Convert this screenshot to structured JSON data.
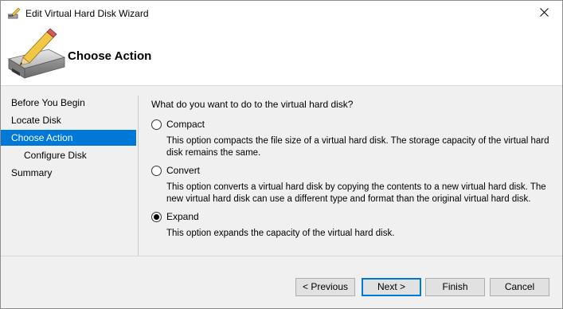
{
  "window": {
    "title": "Edit Virtual Hard Disk Wizard",
    "close_glyph": "✕"
  },
  "header": {
    "title": "Choose Action"
  },
  "nav": {
    "items": [
      {
        "label": "Before You Begin",
        "active": false,
        "sub": false
      },
      {
        "label": "Locate Disk",
        "active": false,
        "sub": false
      },
      {
        "label": "Choose Action",
        "active": true,
        "sub": false
      },
      {
        "label": "Configure Disk",
        "active": false,
        "sub": true
      },
      {
        "label": "Summary",
        "active": false,
        "sub": false
      }
    ],
    "active_color": "#0078d7"
  },
  "main": {
    "question": "What do you want to do to the virtual hard disk?",
    "options": [
      {
        "label": "Compact",
        "checked": false,
        "description": "This option compacts the file size of a virtual hard disk. The storage capacity of the virtual hard disk remains the same."
      },
      {
        "label": "Convert",
        "checked": false,
        "description": "This option converts a virtual hard disk by copying the contents to a new virtual hard disk. The new virtual hard disk can use a different type and format than the original virtual hard disk."
      },
      {
        "label": "Expand",
        "checked": true,
        "description": "This option expands the capacity of the virtual hard disk."
      }
    ]
  },
  "buttons": {
    "previous": "< Previous",
    "next": "Next >",
    "finish": "Finish",
    "cancel": "Cancel"
  },
  "icons": {
    "title": "edit-disk-icon",
    "header": "hard-disk-pencil-icon",
    "close": "close-icon"
  }
}
